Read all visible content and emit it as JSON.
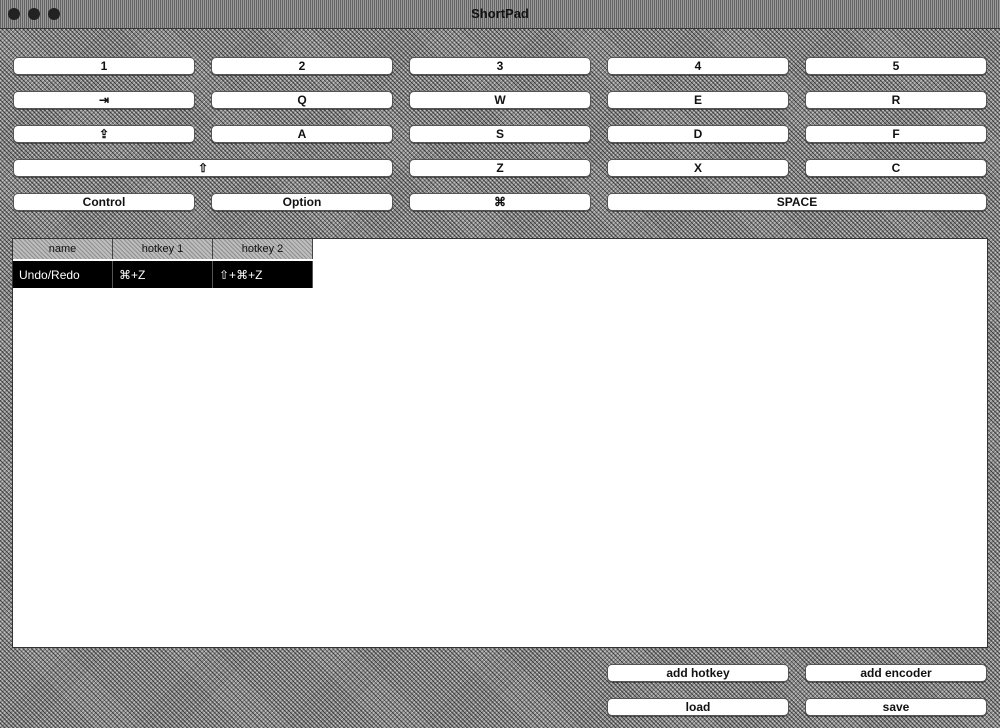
{
  "window": {
    "title": "ShortPad"
  },
  "keys": {
    "k1": "1",
    "k2": "2",
    "k3": "3",
    "k4": "4",
    "k5": "5",
    "tab": "⇥",
    "q": "Q",
    "w": "W",
    "e": "E",
    "r": "R",
    "caps": "⇪",
    "a": "A",
    "s": "S",
    "d": "D",
    "f": "F",
    "shift": "⇧",
    "z": "Z",
    "x": "X",
    "c": "C",
    "control": "Control",
    "option": "Option",
    "command": "⌘",
    "space": "SPACE"
  },
  "table": {
    "headers": [
      "name",
      "hotkey 1",
      "hotkey 2"
    ],
    "rows": [
      [
        "Undo/Redo",
        "⌘+Z",
        "⇧+⌘+Z"
      ]
    ]
  },
  "buttons": {
    "add_hotkey": "add hotkey",
    "add_encoder": "add encoder",
    "load": "load",
    "save": "save"
  }
}
